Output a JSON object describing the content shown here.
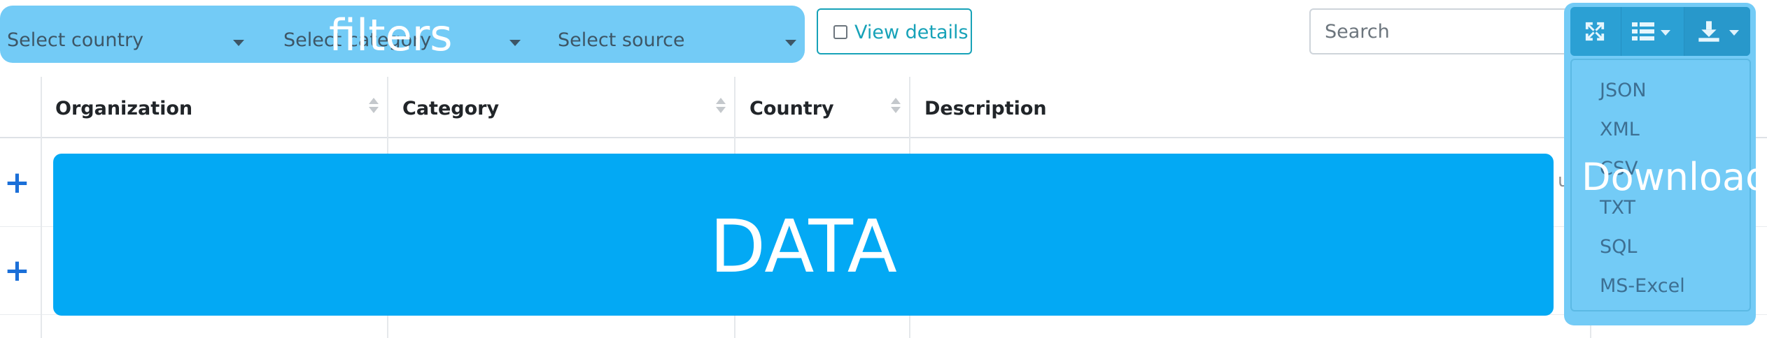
{
  "filters": {
    "label": "filters",
    "selects": [
      {
        "value": "Select country"
      },
      {
        "value": "Select category"
      },
      {
        "value": "Select source"
      }
    ]
  },
  "view_details": {
    "label": "View details",
    "checked": false
  },
  "search": {
    "placeholder": "Search",
    "value": ""
  },
  "toolbar": {
    "fullscreen_icon": "fullscreen-icon",
    "columns_icon": "list-columns-icon",
    "download_icon": "download-icon"
  },
  "download": {
    "label": "Download",
    "menu_items": [
      "JSON",
      "XML",
      "CSV",
      "TXT",
      "SQL",
      "MS-Excel"
    ]
  },
  "table": {
    "columns": [
      "Organization",
      "Category",
      "Country",
      "Description"
    ],
    "row_expand_symbol": "+",
    "partial_text": "u"
  },
  "data_overlay": {
    "label": "DATA"
  },
  "colors": {
    "overlay_light": "#73cbf6",
    "overlay_data": "#03a9f4",
    "toolbar": "#2ba0d4",
    "accent_teal": "#17a2b8",
    "expand_blue": "#1b6fd8"
  }
}
